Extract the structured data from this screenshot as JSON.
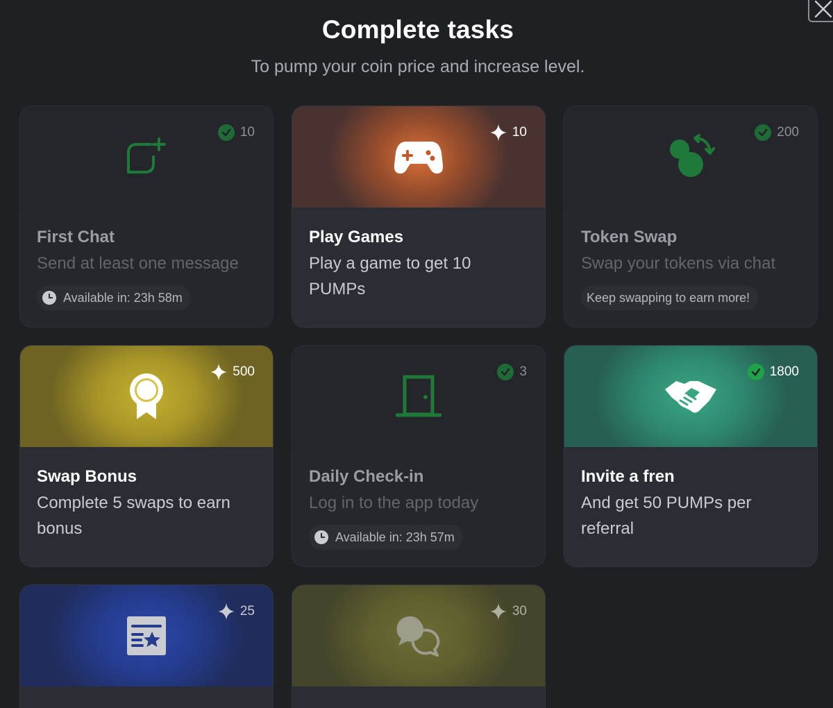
{
  "header": {
    "title": "Complete tasks",
    "subtitle": "To pump your coin price and increase level."
  },
  "colors": {
    "background": "#1f2023",
    "card": "#2a2d33",
    "play_games_accent": "#b35a2e",
    "swap_bonus_accent": "#b8a42a",
    "invite_accent": "#2f8a70",
    "task_blue_accent": "#253c8f",
    "task_olive_accent": "#5f5f2e",
    "done_check": "#1fa24a"
  },
  "tasks": [
    {
      "title": "First Chat",
      "description": "Send at least one message",
      "reward": "10",
      "status": "completed",
      "icon": "chat-plus-icon",
      "availability": "Available in: 23h 58m"
    },
    {
      "title": "Play Games",
      "description": "Play a game to get 10 PUMPs",
      "reward": "10",
      "status": "available",
      "icon": "gamepad-icon"
    },
    {
      "title": "Token Swap",
      "description": "Swap your tokens via chat",
      "reward": "200",
      "status": "completed",
      "icon": "swap-coins-icon",
      "note": "Keep swapping to earn more!"
    },
    {
      "title": "Swap Bonus",
      "description": "Complete 5 swaps to earn bonus",
      "reward": "500",
      "status": "available",
      "icon": "award-badge-icon"
    },
    {
      "title": "Daily Check-in",
      "description": "Log in to the app today",
      "reward": "3",
      "status": "completed",
      "icon": "door-icon",
      "availability": "Available in: 23h 57m"
    },
    {
      "title": "Invite a fren",
      "description": "And get 50 PUMPs per referral",
      "reward": "1800",
      "status": "completed",
      "icon": "handshake-icon"
    },
    {
      "reward": "25",
      "status": "available",
      "icon": "star-list-icon"
    },
    {
      "reward": "30",
      "status": "available",
      "icon": "chat-bubbles-icon"
    }
  ]
}
